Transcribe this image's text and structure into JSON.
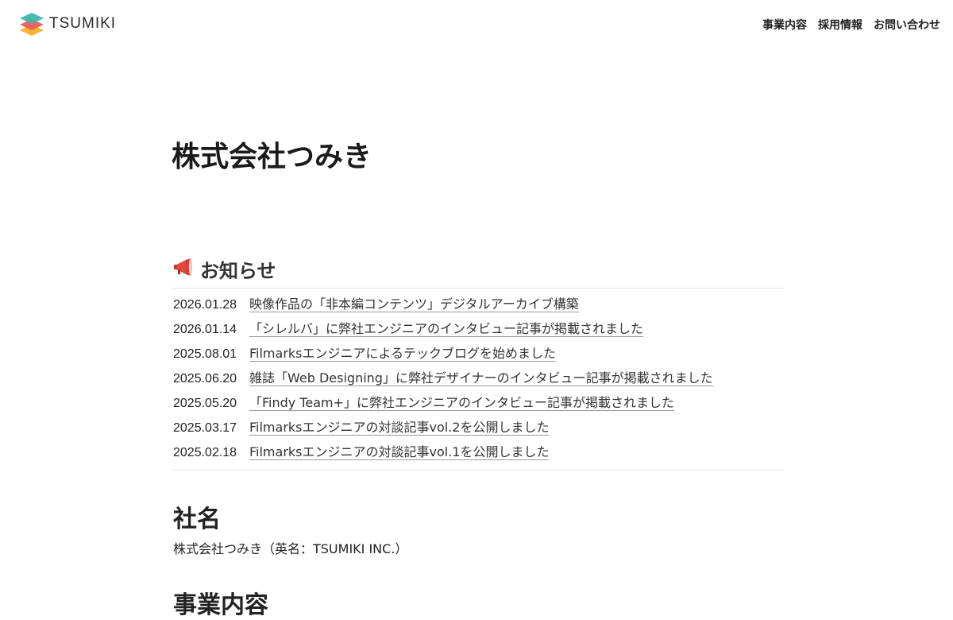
{
  "header": {
    "logo_text": "TSUMIKI",
    "logo_colors": [
      "#3fb6a8",
      "#e85d5d",
      "#f2b632"
    ],
    "nav": [
      {
        "label": "事業内容"
      },
      {
        "label": "採用情報"
      },
      {
        "label": "お問い合わせ"
      }
    ]
  },
  "main": {
    "page_title": "株式会社つみき",
    "news": {
      "heading": "お知らせ",
      "icon": "megaphone-icon",
      "items": [
        {
          "date": "2026.01.28",
          "title": "映像作品の「非本編コンテンツ」デジタルアーカイブ構築"
        },
        {
          "date": "2026.01.14",
          "title": "「シレルバ」に弊社エンジニアのインタビュー記事が掲載されました"
        },
        {
          "date": "2025.08.01",
          "title": "Filmarksエンジニアによるテックブログを始めました"
        },
        {
          "date": "2025.06.20",
          "title": "雑誌「Web Designing」に弊社デザイナーのインタビュー記事が掲載されました"
        },
        {
          "date": "2025.05.20",
          "title": "「Findy Team+」に弊社エンジニアのインタビュー記事が掲載されました"
        },
        {
          "date": "2025.03.17",
          "title": "Filmarksエンジニアの対談記事vol.2を公開しました"
        },
        {
          "date": "2025.02.18",
          "title": "Filmarksエンジニアの対談記事vol.1を公開しました"
        }
      ]
    },
    "company_name": {
      "heading": "社名",
      "value": "株式会社つみき（英名：TSUMIKI INC.）"
    },
    "business": {
      "heading": "事業内容"
    }
  }
}
